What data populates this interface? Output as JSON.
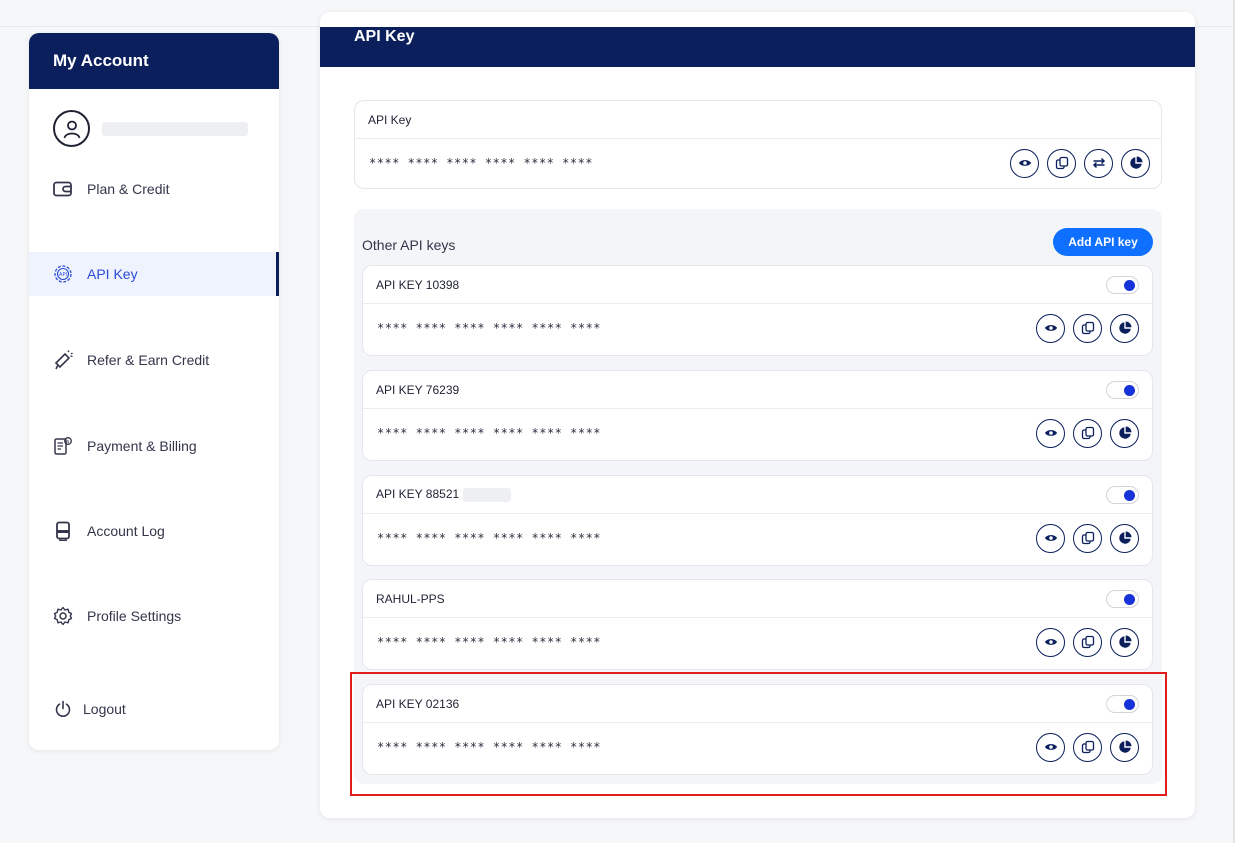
{
  "sidebar": {
    "title": "My Account",
    "items": [
      {
        "label": "Plan & Credit",
        "icon": "wallet-icon"
      },
      {
        "label": "API Key",
        "icon": "api-gear-icon",
        "active": true
      },
      {
        "label": "Refer & Earn Credit",
        "icon": "megaphone-icon"
      },
      {
        "label": "Payment & Billing",
        "icon": "invoice-icon"
      },
      {
        "label": "Account Log",
        "icon": "log-icon"
      },
      {
        "label": "Profile Settings",
        "icon": "gear-icon"
      },
      {
        "label": "Logout",
        "icon": "power-icon"
      }
    ]
  },
  "main": {
    "title": "API Key",
    "primary_key": {
      "label": "API Key",
      "masked_value": "**** **** **** **** **** ****"
    },
    "other_keys": {
      "title": "Other API keys",
      "add_button_label": "Add API key",
      "keys": [
        {
          "name": "API KEY 10398",
          "masked_value": "**** **** **** **** **** ****",
          "enabled": true
        },
        {
          "name": "API KEY 76239",
          "masked_value": "**** **** **** **** **** ****",
          "enabled": true
        },
        {
          "name": "API KEY 88521",
          "masked_value": "**** **** **** **** **** ****",
          "enabled": true
        },
        {
          "name": "RAHUL-PPS",
          "masked_value": "**** **** **** **** **** ****",
          "enabled": true
        },
        {
          "name": "API KEY 02136",
          "masked_value": "**** **** **** **** **** ****",
          "enabled": true
        }
      ]
    }
  },
  "colors": {
    "navy": "#0b1f5c",
    "accent_blue": "#0f6fff",
    "toggle_on": "#1632d9",
    "highlight_red": "#e01e1e"
  }
}
